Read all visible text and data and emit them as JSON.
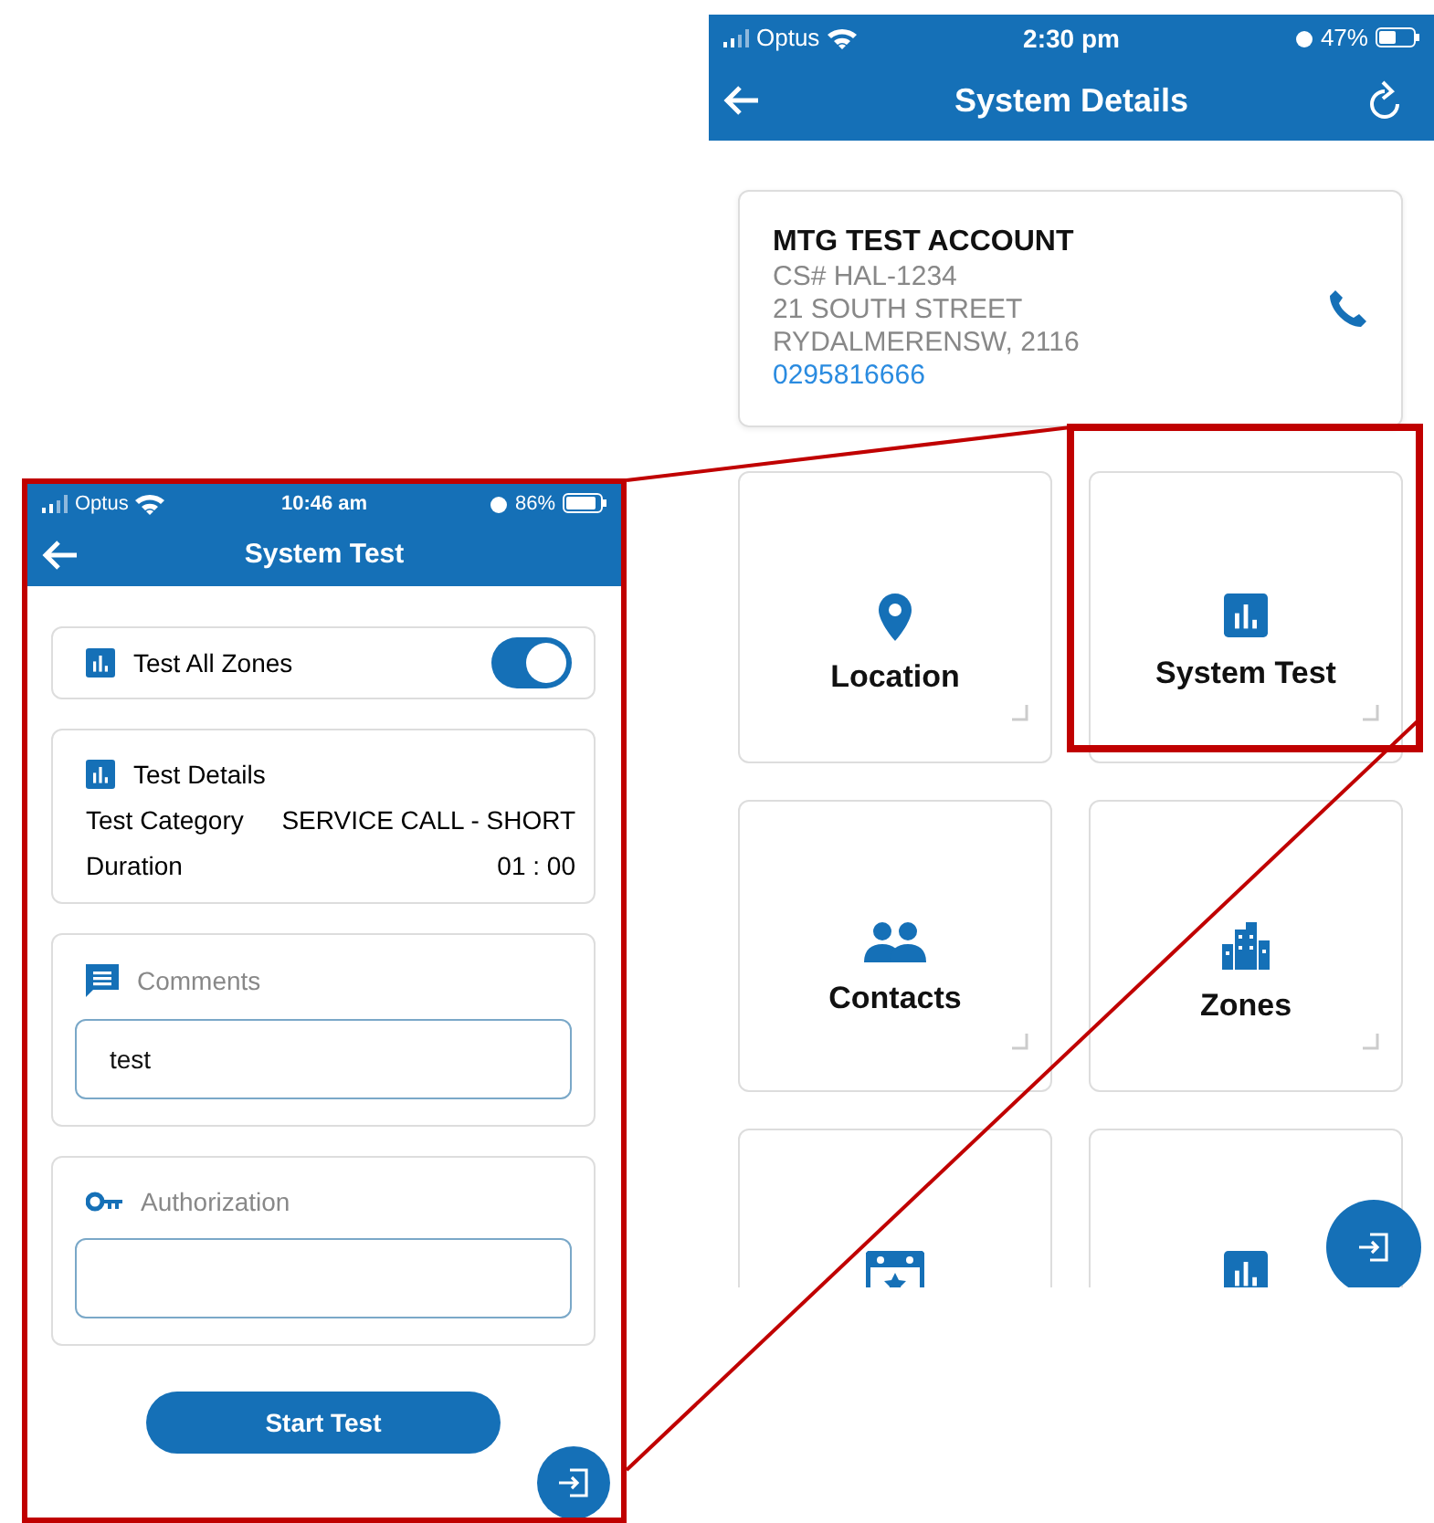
{
  "main_screen": {
    "status_bar": {
      "carrier": "Optus",
      "time": "2:30 pm",
      "battery": "47%"
    },
    "header": {
      "title": "System Details"
    },
    "account": {
      "name": "MTG TEST ACCOUNT",
      "cs": "CS# HAL-1234",
      "address_1": "21 SOUTH STREET",
      "address_2": "RYDALMERENSW, 2116",
      "phone": "0295816666"
    },
    "tiles": [
      {
        "kind": "pin",
        "label": "Location",
        "highlighted": false
      },
      {
        "kind": "chart",
        "label": "System Test",
        "highlighted": true
      },
      {
        "kind": "people",
        "label": "Contacts",
        "highlighted": false
      },
      {
        "kind": "building",
        "label": "Zones",
        "highlighted": false
      },
      {
        "kind": "calendar",
        "highlighted": false
      },
      {
        "kind": "chart",
        "highlighted": false
      }
    ]
  },
  "callout_screen": {
    "status_bar": {
      "carrier": "Optus",
      "time": "10:46 am",
      "battery": "86%"
    },
    "header": {
      "title": "System Test"
    },
    "toggle": {
      "label": "Test All Zones",
      "on": true
    },
    "details": {
      "title": "Test Details",
      "rows": [
        {
          "label": "Test Category",
          "value": "SERVICE CALL - SHORT"
        },
        {
          "label": "Duration",
          "value": "01 : 00"
        }
      ]
    },
    "comments": {
      "label": "Comments",
      "value": "test"
    },
    "authorization": {
      "label": "Authorization"
    },
    "button": "Start Test"
  }
}
